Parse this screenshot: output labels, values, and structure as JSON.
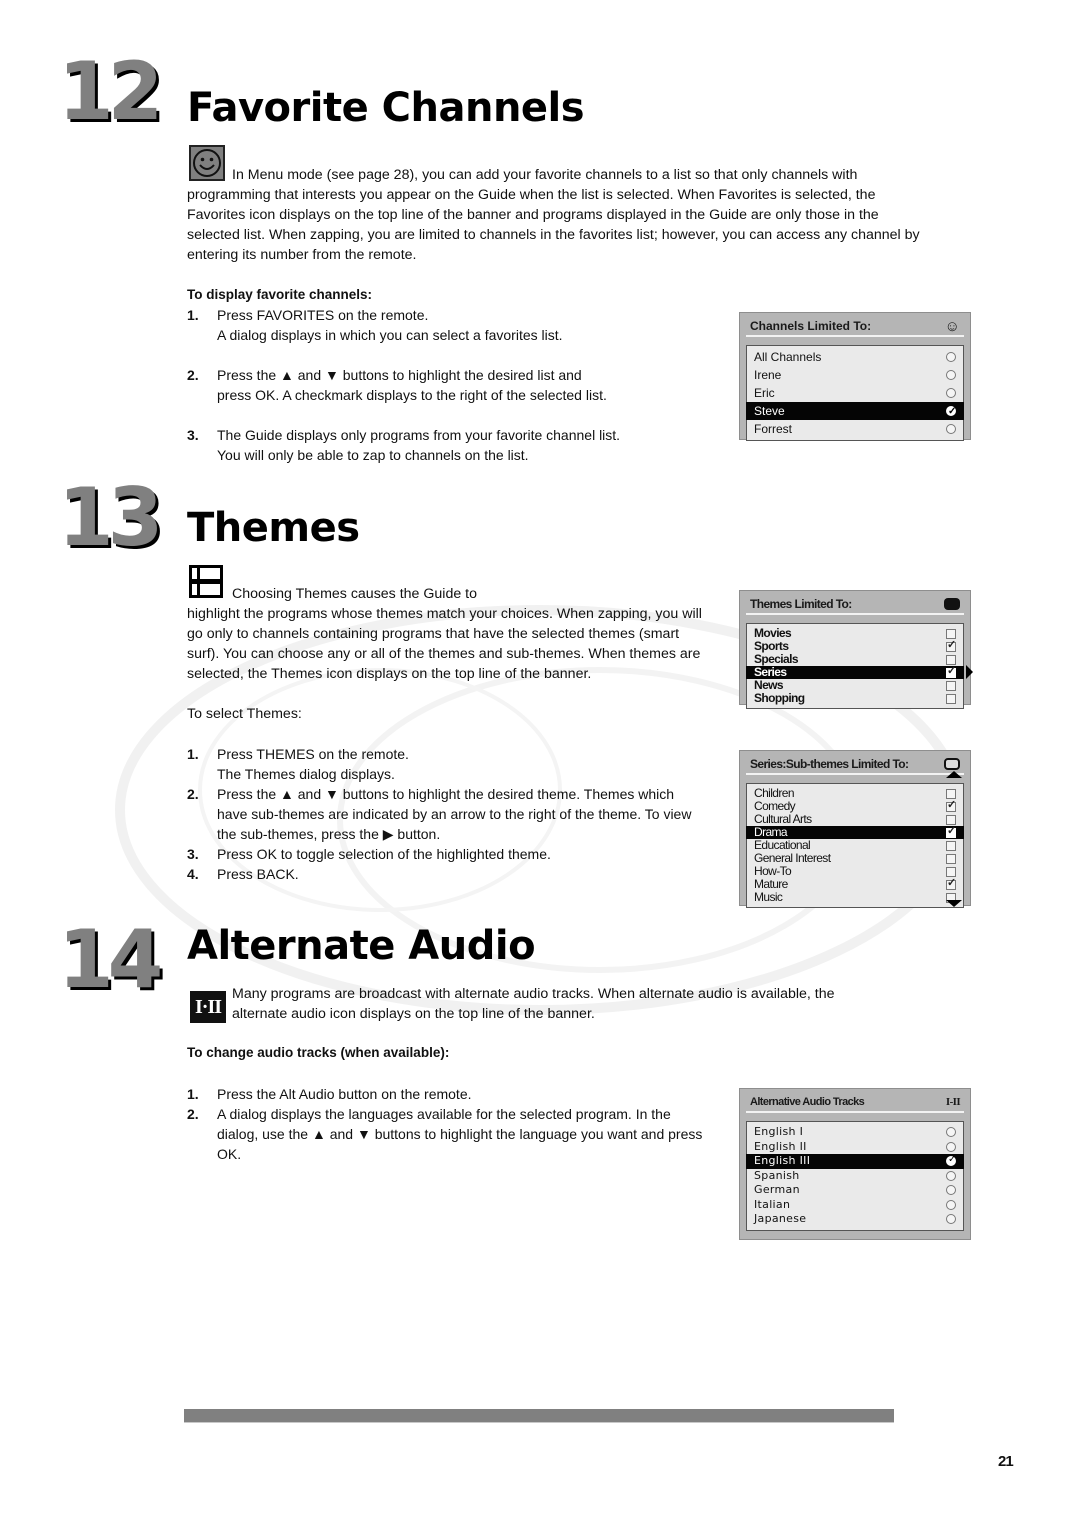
{
  "sections": {
    "favorites": {
      "number": "12",
      "title": "Favorite Channels",
      "icon": "smiley-face-icon",
      "intro": [
        "In Menu mode (see page 28), you can add your favorite channels to a list so that only channels with",
        "programming that interests you appear on the Guide when the list is selected. When Favorites is selected, the",
        "Favorites icon displays on the top line of the banner and programs displayed in the Guide are only those in the",
        "selected list. When zapping, you are limited to channels in the favorites list; however, you can access any channel by",
        "entering its number from the remote."
      ],
      "subheading": "To display favorite channels:",
      "steps": [
        {
          "n": "1.",
          "lines": [
            "Press FAVORITES on the remote.",
            "A dialog displays in which you can select a favorites list."
          ]
        },
        {
          "n": "2.",
          "lines": [
            "Press the ▲ and ▼ buttons to highlight the desired list and",
            "press OK. A checkmark displays to the right of the selected list."
          ]
        },
        {
          "n": "3.",
          "lines": [
            "The Guide displays only programs from your favorite channel list.",
            "You will only be able to zap to channels on the list."
          ]
        }
      ],
      "dialog": {
        "title": "Channels Limited To:",
        "header_icon": "☺",
        "items": [
          {
            "label": "All Channels",
            "checked": false,
            "selected": false
          },
          {
            "label": "Irene",
            "checked": false,
            "selected": false
          },
          {
            "label": "Eric",
            "checked": false,
            "selected": false
          },
          {
            "label": "Steve",
            "checked": true,
            "selected": true
          },
          {
            "label": "Forrest",
            "checked": false,
            "selected": false
          }
        ]
      }
    },
    "themes": {
      "number": "13",
      "title": "Themes",
      "icon": "themes-grid-icon",
      "intro_first": "Choosing Themes causes the Guide to",
      "intro": [
        "highlight the programs whose themes match your choices. When zapping, you will",
        "go only to channels containing programs that have the selected themes (smart",
        "surf). You can choose any or all of the themes and sub-themes. When themes are",
        "selected, the Themes icon displays on the top line of the banner."
      ],
      "subheading": "To select Themes:",
      "steps": [
        {
          "n": "1.",
          "lines": [
            "Press THEMES on the remote.",
            "The Themes dialog displays."
          ]
        },
        {
          "n": "2.",
          "lines": [
            "Press the ▲ and ▼ buttons to highlight the desired theme. Themes which",
            "have sub-themes are indicated by an arrow to the right of the theme. To view",
            "the sub-themes, press the ▶ button."
          ]
        },
        {
          "n": "3.",
          "lines": [
            "Press OK to toggle selection of the highlighted theme."
          ]
        },
        {
          "n": "4.",
          "lines": [
            "Press BACK."
          ]
        }
      ],
      "dialog": {
        "title": "Themes Limited To:",
        "items": [
          {
            "label": "Movies",
            "checked": false,
            "selected": false
          },
          {
            "label": "Sports",
            "checked": true,
            "selected": false
          },
          {
            "label": "Specials",
            "checked": false,
            "selected": false
          },
          {
            "label": "Series",
            "checked": true,
            "selected": true,
            "has_subthemes": true
          },
          {
            "label": "News",
            "checked": false,
            "selected": false
          },
          {
            "label": "Shopping",
            "checked": false,
            "selected": false
          }
        ]
      },
      "subdialog": {
        "title": "Series:Sub-themes Limited To:",
        "items": [
          {
            "label": "Children",
            "checked": false,
            "selected": false
          },
          {
            "label": "Comedy",
            "checked": true,
            "selected": false
          },
          {
            "label": "Cultural Arts",
            "checked": false,
            "selected": false
          },
          {
            "label": "Drama",
            "checked": true,
            "selected": true
          },
          {
            "label": "Educational",
            "checked": false,
            "selected": false
          },
          {
            "label": "General Interest",
            "checked": false,
            "selected": false
          },
          {
            "label": "How-To",
            "checked": false,
            "selected": false
          },
          {
            "label": "Mature",
            "checked": true,
            "selected": false
          },
          {
            "label": "Music",
            "checked": false,
            "selected": false
          }
        ]
      }
    },
    "audio": {
      "number": "14",
      "title": "Alternate Audio",
      "icon_text": "I·II",
      "intro": [
        "Many programs are broadcast with alternate audio tracks. When alternate audio is available, the",
        "alternate audio icon displays on the top line of the banner."
      ],
      "subheading": "To change audio tracks (when available):",
      "steps": [
        {
          "n": "1.",
          "lines": [
            "Press the Alt Audio button on the remote."
          ]
        },
        {
          "n": "2.",
          "lines": [
            "A dialog displays the languages available for the selected program. In the",
            "dialog, use the ▲ and ▼ buttons to highlight the language you want and press",
            "OK."
          ]
        }
      ],
      "dialog": {
        "title": "Alternative Audio Tracks",
        "header_icon": "I-II",
        "items": [
          {
            "label": "English I",
            "checked": false,
            "selected": false
          },
          {
            "label": "English II",
            "checked": false,
            "selected": false
          },
          {
            "label": "English III",
            "checked": true,
            "selected": true
          },
          {
            "label": "Spanish",
            "checked": false,
            "selected": false
          },
          {
            "label": "German",
            "checked": false,
            "selected": false
          },
          {
            "label": "Italian",
            "checked": false,
            "selected": false
          },
          {
            "label": "Japanese",
            "checked": false,
            "selected": false
          }
        ]
      }
    }
  },
  "footer": {
    "page_number": "21"
  }
}
